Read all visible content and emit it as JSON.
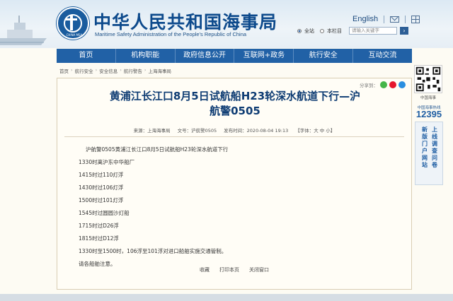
{
  "header": {
    "title": "中华人民共和国海事局",
    "subtitle": "Maritime Safety Administration of the People's Republic of China",
    "emblem_text": "CHINA MSA",
    "english_link": "English"
  },
  "search": {
    "scope_all": "全站",
    "scope_column": "本栏目",
    "placeholder": "请输入关键字"
  },
  "nav": [
    "首页",
    "机构职能",
    "政府信息公开",
    "互联网+政务",
    "航行安全",
    "互动交流"
  ],
  "breadcrumb": [
    "首页",
    "航行安全",
    "安全信息",
    "航行警告",
    "上海海事局"
  ],
  "share_label": "分享到：",
  "article": {
    "title_line1": "黄浦江长江口8月5日试航船H23轮深水航道下行—沪",
    "title_line2": "航警0505",
    "source": "来源：上海海事局",
    "doc_no": "文号：沪航警0505",
    "date": "发布时间：2020-08-04 19:13",
    "font_size": "【字体：大  中  小】",
    "lines": [
      "沪航警0505黄浦江长江口8月5日试航船H23轮深水航道下行",
      "1330时离沪东中华船厂",
      "1415时过110灯浮",
      "1430时过106灯浮",
      "1500时过101灯浮",
      "1545时过圆圆沙灯船",
      "1715时过D26浮",
      "1815时过D12浮",
      "1330时至1500时，106浮至101浮对进口船舶实施交通管制。",
      "请各船舶注意。"
    ]
  },
  "actions": [
    "收藏",
    "打印本页",
    "关闭窗口"
  ],
  "sidebar": {
    "qr_label": "中国海事",
    "hotline_label": "中国海事热线",
    "hotline": "12395",
    "banner_col1": "新版门户网站",
    "banner_col2": "上线调查问卷"
  },
  "colors": {
    "nav_bg": "#2161a6",
    "title_color": "#0e3c73",
    "brand": "#0d4a8c"
  }
}
